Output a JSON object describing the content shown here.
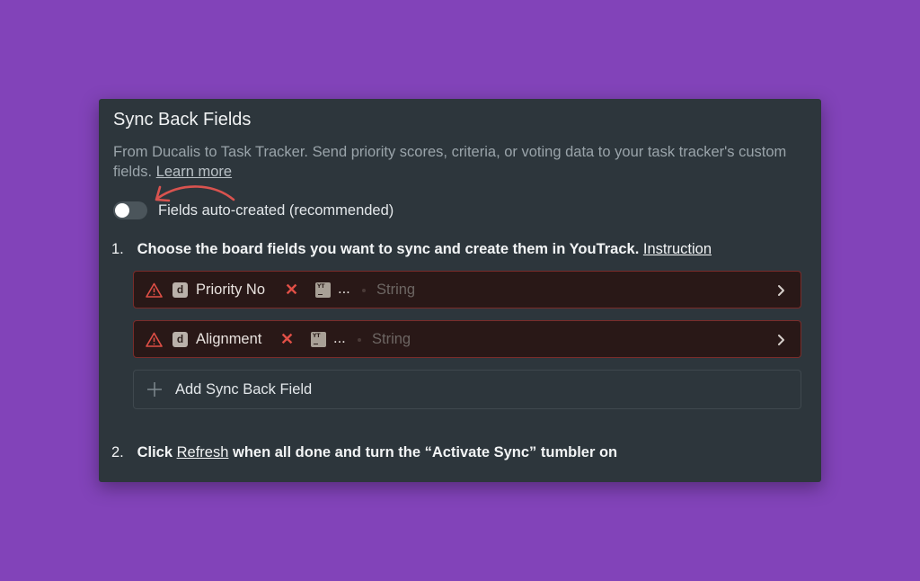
{
  "panel": {
    "title": "Sync Back Fields",
    "description": "From Ducalis to Task Tracker. Send priority scores, criteria, or voting data to your task tracker's custom fields.",
    "learn_more": "Learn more",
    "toggle_label": "Fields auto-created (recommended)",
    "toggle_on": false
  },
  "steps": [
    {
      "num": "1.",
      "text": "Choose the board fields you want to sync and create them in YouTrack.",
      "link": "Instruction"
    },
    {
      "num": "2.",
      "text_before": "Click",
      "link": "Refresh",
      "text_after": "when all done and turn the “Activate Sync” tumbler on"
    }
  ],
  "fields": [
    {
      "source_badge": "d",
      "name": "Priority No",
      "target": "...",
      "type": "String",
      "yt_badge": "YT"
    },
    {
      "source_badge": "d",
      "name": "Alignment",
      "target": "...",
      "type": "String",
      "yt_badge": "YT"
    }
  ],
  "add_field_label": "Add Sync Back Field",
  "colors": {
    "background": "#8243b9",
    "panel": "#2d363c",
    "error_row": "#291817",
    "error_border": "#7a2c2a",
    "error_icon": "#e04f46",
    "annotation_arrow": "#d9534f"
  },
  "icons": [
    "warning-icon",
    "chevron-right-icon",
    "close-icon",
    "plus-icon",
    "youtrack-icon",
    "ducalis-icon"
  ]
}
